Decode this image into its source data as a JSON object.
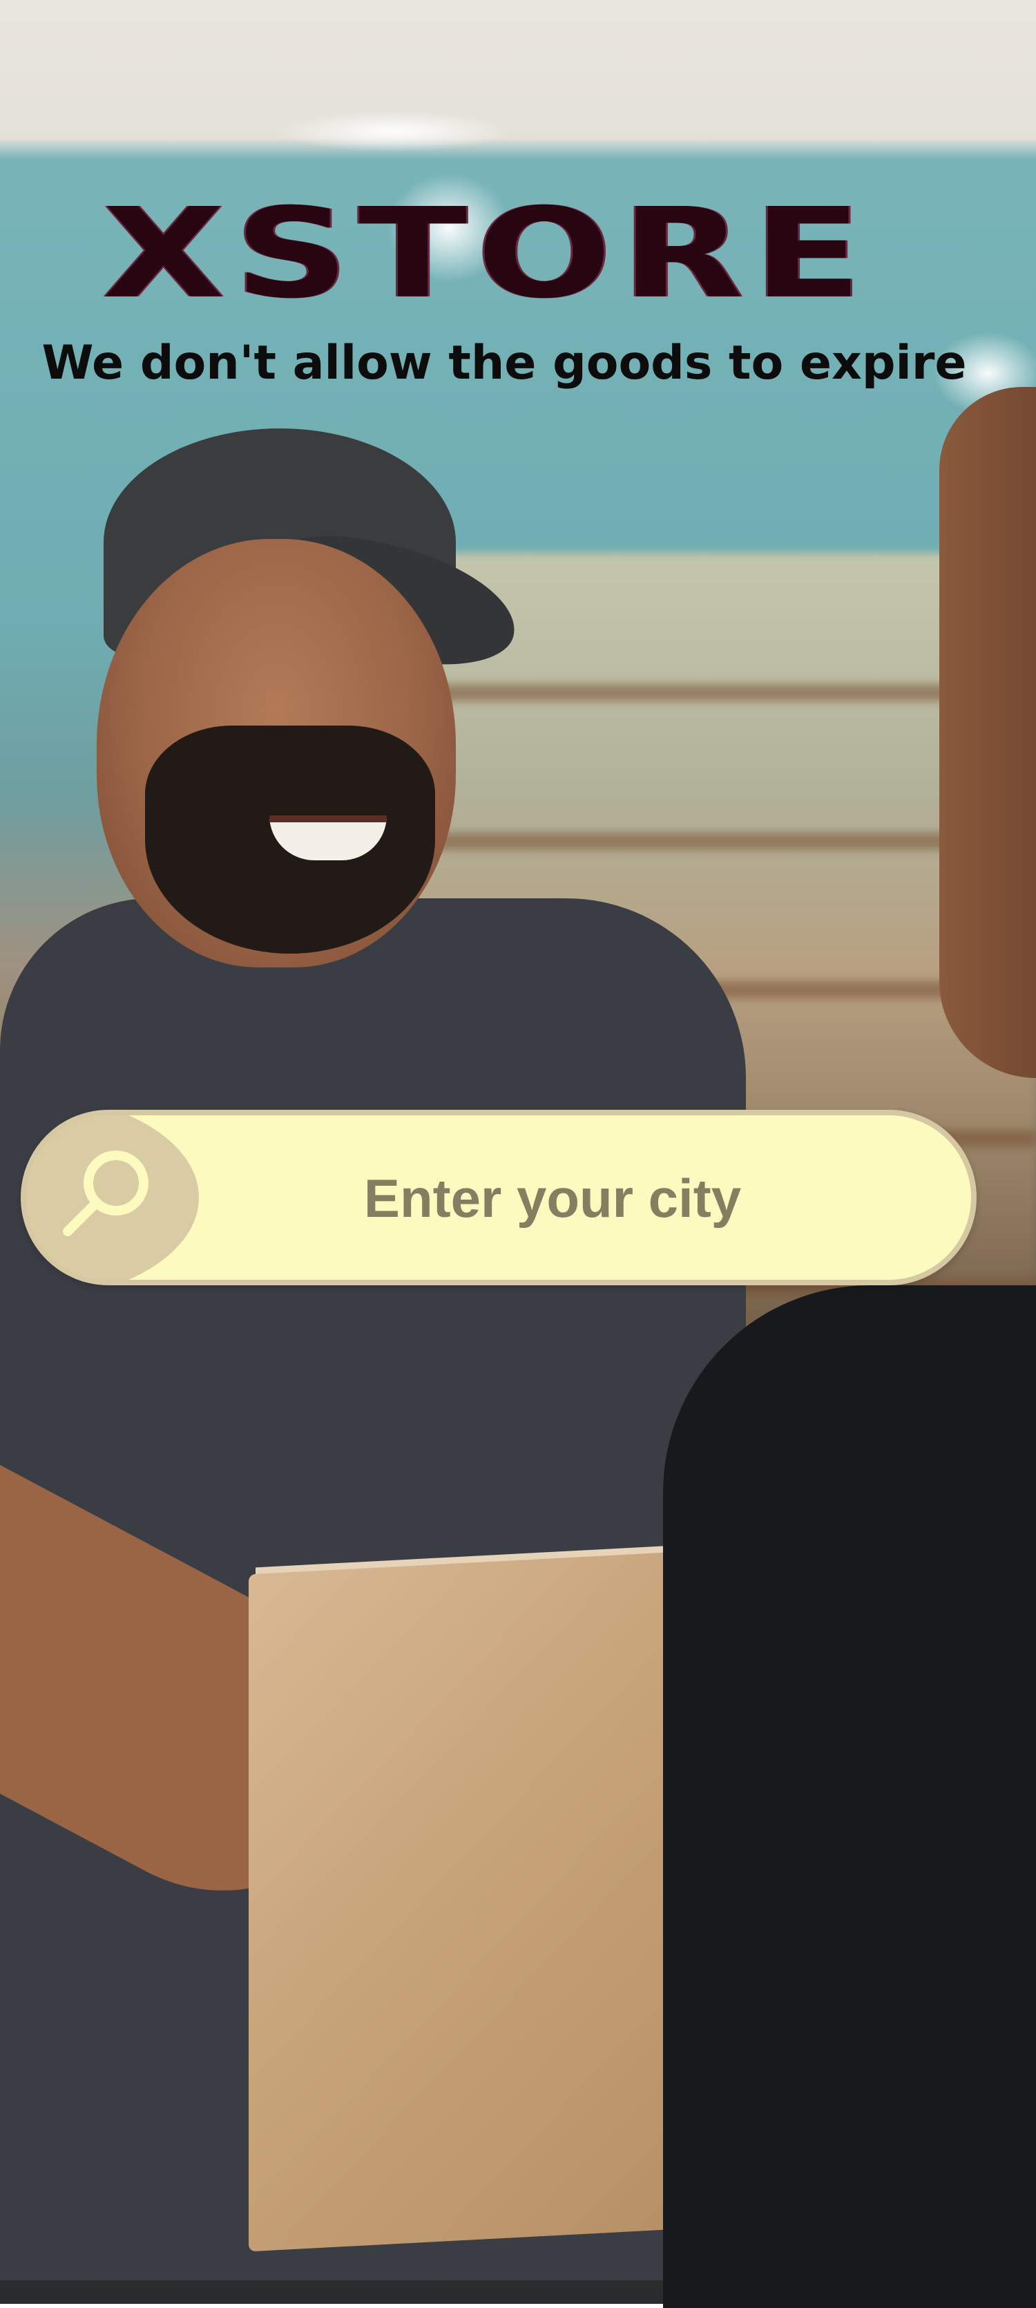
{
  "header": {
    "brand": "XSTORE",
    "tagline": "We don't allow the goods to expire"
  },
  "search": {
    "placeholder": "Enter your city",
    "value": "",
    "icon": "magnifier-icon"
  },
  "colors": {
    "brand_text": "#280611",
    "search_bg": "#fdfac0",
    "search_icon_bg": "#d9cba4",
    "search_text": "#857f62"
  }
}
